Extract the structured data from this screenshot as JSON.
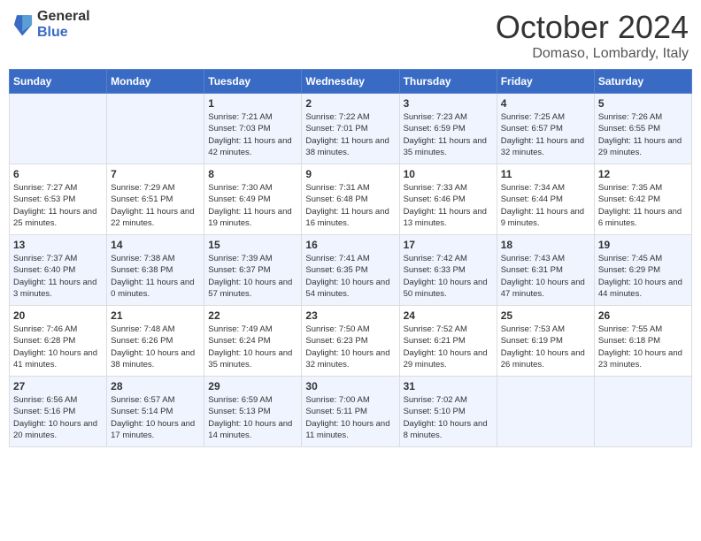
{
  "logo": {
    "general": "General",
    "blue": "Blue"
  },
  "title": "October 2024",
  "location": "Domaso, Lombardy, Italy",
  "weekdays": [
    "Sunday",
    "Monday",
    "Tuesday",
    "Wednesday",
    "Thursday",
    "Friday",
    "Saturday"
  ],
  "weeks": [
    [
      {
        "day": "",
        "info": ""
      },
      {
        "day": "",
        "info": ""
      },
      {
        "day": "1",
        "info": "Sunrise: 7:21 AM\nSunset: 7:03 PM\nDaylight: 11 hours and 42 minutes."
      },
      {
        "day": "2",
        "info": "Sunrise: 7:22 AM\nSunset: 7:01 PM\nDaylight: 11 hours and 38 minutes."
      },
      {
        "day": "3",
        "info": "Sunrise: 7:23 AM\nSunset: 6:59 PM\nDaylight: 11 hours and 35 minutes."
      },
      {
        "day": "4",
        "info": "Sunrise: 7:25 AM\nSunset: 6:57 PM\nDaylight: 11 hours and 32 minutes."
      },
      {
        "day": "5",
        "info": "Sunrise: 7:26 AM\nSunset: 6:55 PM\nDaylight: 11 hours and 29 minutes."
      }
    ],
    [
      {
        "day": "6",
        "info": "Sunrise: 7:27 AM\nSunset: 6:53 PM\nDaylight: 11 hours and 25 minutes."
      },
      {
        "day": "7",
        "info": "Sunrise: 7:29 AM\nSunset: 6:51 PM\nDaylight: 11 hours and 22 minutes."
      },
      {
        "day": "8",
        "info": "Sunrise: 7:30 AM\nSunset: 6:49 PM\nDaylight: 11 hours and 19 minutes."
      },
      {
        "day": "9",
        "info": "Sunrise: 7:31 AM\nSunset: 6:48 PM\nDaylight: 11 hours and 16 minutes."
      },
      {
        "day": "10",
        "info": "Sunrise: 7:33 AM\nSunset: 6:46 PM\nDaylight: 11 hours and 13 minutes."
      },
      {
        "day": "11",
        "info": "Sunrise: 7:34 AM\nSunset: 6:44 PM\nDaylight: 11 hours and 9 minutes."
      },
      {
        "day": "12",
        "info": "Sunrise: 7:35 AM\nSunset: 6:42 PM\nDaylight: 11 hours and 6 minutes."
      }
    ],
    [
      {
        "day": "13",
        "info": "Sunrise: 7:37 AM\nSunset: 6:40 PM\nDaylight: 11 hours and 3 minutes."
      },
      {
        "day": "14",
        "info": "Sunrise: 7:38 AM\nSunset: 6:38 PM\nDaylight: 11 hours and 0 minutes."
      },
      {
        "day": "15",
        "info": "Sunrise: 7:39 AM\nSunset: 6:37 PM\nDaylight: 10 hours and 57 minutes."
      },
      {
        "day": "16",
        "info": "Sunrise: 7:41 AM\nSunset: 6:35 PM\nDaylight: 10 hours and 54 minutes."
      },
      {
        "day": "17",
        "info": "Sunrise: 7:42 AM\nSunset: 6:33 PM\nDaylight: 10 hours and 50 minutes."
      },
      {
        "day": "18",
        "info": "Sunrise: 7:43 AM\nSunset: 6:31 PM\nDaylight: 10 hours and 47 minutes."
      },
      {
        "day": "19",
        "info": "Sunrise: 7:45 AM\nSunset: 6:29 PM\nDaylight: 10 hours and 44 minutes."
      }
    ],
    [
      {
        "day": "20",
        "info": "Sunrise: 7:46 AM\nSunset: 6:28 PM\nDaylight: 10 hours and 41 minutes."
      },
      {
        "day": "21",
        "info": "Sunrise: 7:48 AM\nSunset: 6:26 PM\nDaylight: 10 hours and 38 minutes."
      },
      {
        "day": "22",
        "info": "Sunrise: 7:49 AM\nSunset: 6:24 PM\nDaylight: 10 hours and 35 minutes."
      },
      {
        "day": "23",
        "info": "Sunrise: 7:50 AM\nSunset: 6:23 PM\nDaylight: 10 hours and 32 minutes."
      },
      {
        "day": "24",
        "info": "Sunrise: 7:52 AM\nSunset: 6:21 PM\nDaylight: 10 hours and 29 minutes."
      },
      {
        "day": "25",
        "info": "Sunrise: 7:53 AM\nSunset: 6:19 PM\nDaylight: 10 hours and 26 minutes."
      },
      {
        "day": "26",
        "info": "Sunrise: 7:55 AM\nSunset: 6:18 PM\nDaylight: 10 hours and 23 minutes."
      }
    ],
    [
      {
        "day": "27",
        "info": "Sunrise: 6:56 AM\nSunset: 5:16 PM\nDaylight: 10 hours and 20 minutes."
      },
      {
        "day": "28",
        "info": "Sunrise: 6:57 AM\nSunset: 5:14 PM\nDaylight: 10 hours and 17 minutes."
      },
      {
        "day": "29",
        "info": "Sunrise: 6:59 AM\nSunset: 5:13 PM\nDaylight: 10 hours and 14 minutes."
      },
      {
        "day": "30",
        "info": "Sunrise: 7:00 AM\nSunset: 5:11 PM\nDaylight: 10 hours and 11 minutes."
      },
      {
        "day": "31",
        "info": "Sunrise: 7:02 AM\nSunset: 5:10 PM\nDaylight: 10 hours and 8 minutes."
      },
      {
        "day": "",
        "info": ""
      },
      {
        "day": "",
        "info": ""
      }
    ]
  ]
}
